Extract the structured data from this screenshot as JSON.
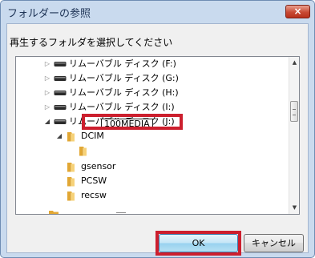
{
  "dialog": {
    "title": "フォルダーの参照",
    "close_label": "×",
    "prompt": "再生するフォルダを選択してください"
  },
  "tree": {
    "items": [
      {
        "label": "リムーバブル ディスク (F:)",
        "icon": "drive-icon",
        "expander": "collapsed"
      },
      {
        "label": "リムーバブル ディスク (G:)",
        "icon": "drive-icon",
        "expander": "collapsed"
      },
      {
        "label": "リムーバブル ディスク (H:)",
        "icon": "drive-icon",
        "expander": "collapsed"
      },
      {
        "label": "リムーバブル ディスク (I:)",
        "icon": "drive-icon",
        "expander": "collapsed"
      },
      {
        "label": "リムーバブル ディスク (J:)",
        "icon": "drive-icon",
        "expander": "expanded"
      },
      {
        "label": "DCIM",
        "icon": "folder-icon",
        "expander": "expanded"
      },
      {
        "label": "100MEDIA",
        "icon": "folder-icon",
        "expander": "none",
        "state": "renaming"
      },
      {
        "label": "gsensor",
        "icon": "folder-icon",
        "expander": "none"
      },
      {
        "label": "PCSW",
        "icon": "folder-icon",
        "expander": "none"
      },
      {
        "label": "recsw",
        "icon": "folder-icon",
        "expander": "none"
      }
    ]
  },
  "buttons": {
    "ok": "OK",
    "cancel": "キャンセル"
  },
  "colors": {
    "highlight": "#cc1f2e",
    "title_bar": "#c9daee",
    "close_button": "#c84a34"
  }
}
